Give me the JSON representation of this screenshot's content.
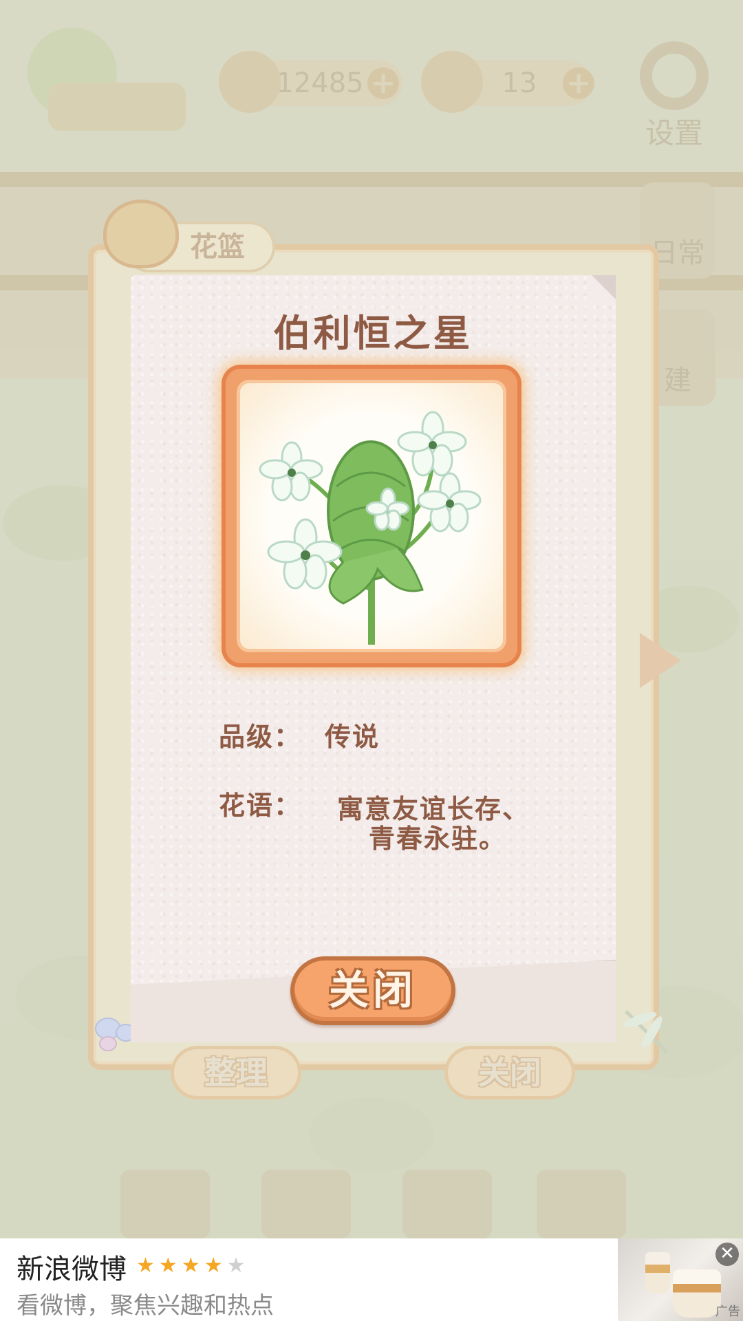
{
  "topbar": {
    "fish_count": "12485",
    "cheese_count": "13",
    "settings_label": "设置"
  },
  "background": {
    "side_buttons": [
      "日常",
      "建"
    ],
    "basket_tab_label": "花篮",
    "organize_label": "整理",
    "close_label": "关闭"
  },
  "flower_card": {
    "name": "伯利恒之星",
    "grade_label": "品级：",
    "grade_value": "传说",
    "meaning_label": "花语：",
    "meaning_line1": "寓意友谊长存、",
    "meaning_line2": "青春永驻。",
    "close_button": "关闭"
  },
  "ad": {
    "app_name": "新浪微博",
    "rating": 4,
    "rating_max": 5,
    "subtitle": "看微博，聚焦兴趣和热点",
    "tag": "广告",
    "close_icon": "close-icon"
  },
  "colors": {
    "text_brown": "#8e5a44",
    "button_orange": "#f6a46b",
    "frame_orange": "#f0a06b",
    "star_gold": "#f5a623"
  }
}
